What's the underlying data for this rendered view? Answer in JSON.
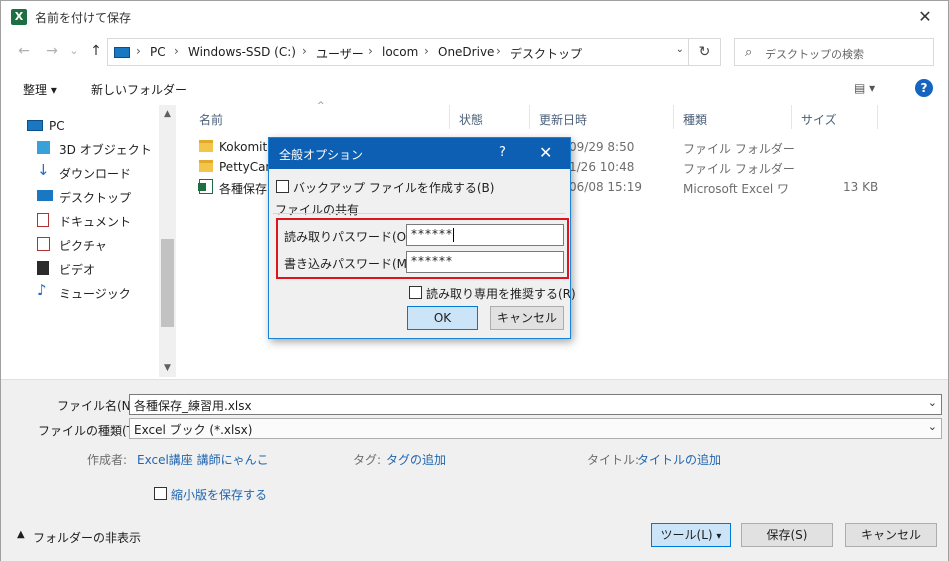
{
  "window": {
    "title": "名前を付けて保存",
    "app_icon": "excel-icon"
  },
  "nav": {
    "back": "←",
    "forward": "→",
    "recent": "⌄",
    "up": "↑",
    "breadcrumbs": [
      "PC",
      "Windows-SSD (C:)",
      "ユーザー",
      "locom",
      "OneDrive",
      "デスクトップ"
    ],
    "search_placeholder": "デスクトップの検索"
  },
  "toolbar": {
    "organize": "整理 ▾",
    "new_folder": "新しいフォルダー",
    "view": "▤ ▾",
    "help": "?"
  },
  "sidebar": {
    "items": [
      {
        "label": "PC",
        "icon": "pc-icon"
      },
      {
        "label": "3D オブジェクト",
        "icon": "3d-objects-icon"
      },
      {
        "label": "ダウンロード",
        "icon": "download-icon"
      },
      {
        "label": "デスクトップ",
        "icon": "desktop-icon"
      },
      {
        "label": "ドキュメント",
        "icon": "documents-icon"
      },
      {
        "label": "ピクチャ",
        "icon": "pictures-icon"
      },
      {
        "label": "ビデオ",
        "icon": "video-icon"
      },
      {
        "label": "ミュージック",
        "icon": "music-icon"
      }
    ]
  },
  "columns": {
    "name": "名前",
    "status": "状態",
    "modified": "更新日時",
    "type": "種類",
    "size": "サイズ"
  },
  "files": [
    {
      "name": "Kokomite",
      "modified": "09/29 8:50",
      "type": "ファイル フォルダー",
      "size": ""
    },
    {
      "name": "PettyCam",
      "modified": "1/26 10:48",
      "type": "ファイル フォルダー",
      "size": ""
    },
    {
      "name": "各種保存",
      "modified": "06/08 15:19",
      "type": "Microsoft Excel ワ",
      "size": "13 KB"
    }
  ],
  "form": {
    "filename_label": "ファイル名(N):",
    "filename_value": "各種保存_練習用.xlsx",
    "filetype_label": "ファイルの種類(T):",
    "filetype_value": "Excel ブック (*.xlsx)",
    "author_label": "作成者:",
    "author_value": "Excel講座 講師にゃんこ",
    "tag_label": "タグ:",
    "tag_value": "タグの追加",
    "title_label": "タイトル:",
    "title_value": "タイトルの追加",
    "thumbnail_label": "縮小版を保存する",
    "hide_folders": "フォルダーの非表示",
    "tools": "ツール(L)",
    "save": "保存(S)",
    "cancel": "キャンセル"
  },
  "dialog": {
    "title": "全般オプション",
    "help": "?",
    "close": "✕",
    "backup_label": "バックアップ ファイルを作成する(B)",
    "share_group": "ファイルの共有",
    "read_pw_label": "読み取りパスワード(O):",
    "read_pw_value": "******",
    "write_pw_label": "書き込みパスワード(M):",
    "write_pw_value": "******",
    "readonly_label": "読み取り専用を推奨する(R)",
    "ok": "OK",
    "cancel": "キャンセル"
  }
}
